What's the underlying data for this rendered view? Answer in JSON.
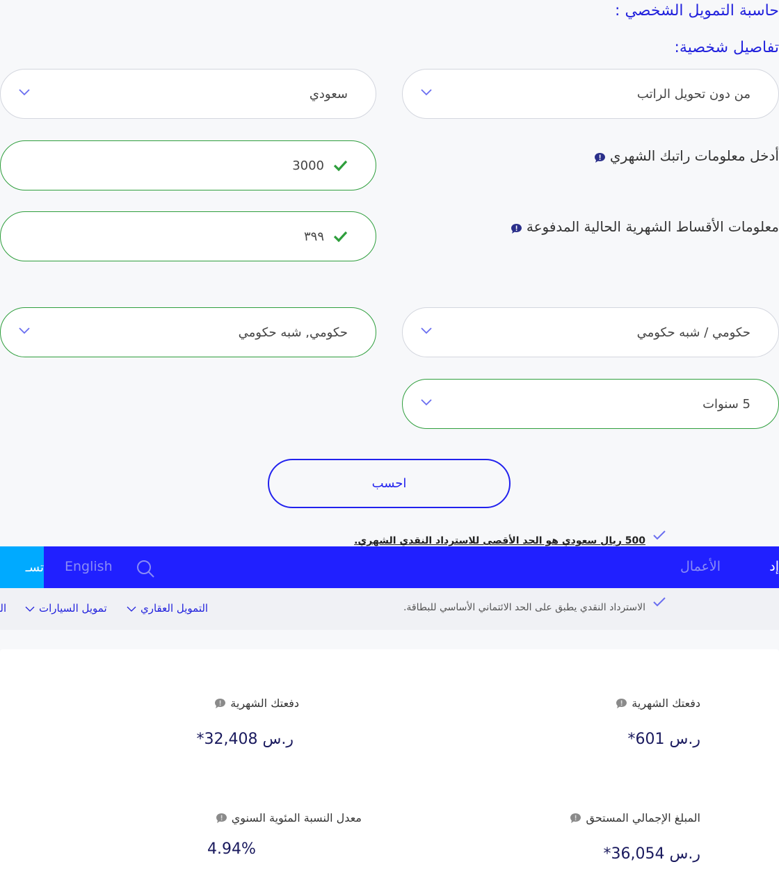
{
  "page": {
    "title": "حاسبة التمويل الشخصي :",
    "subtitle": "تفاصيل شخصية:"
  },
  "form": {
    "salary_transfer": {
      "value": "من دون تحويل الراتب",
      "icon": "chevron-down-icon"
    },
    "nationality": {
      "value": "سعودي",
      "icon": "chevron-down-icon"
    },
    "salary_label": "أدخل معلومات راتبك الشهري",
    "salary_value": "3000",
    "installments_label": "معلومات الأقساط الشهرية الحالية المدفوعة",
    "installments_value": "٣٩٩",
    "employer_type": {
      "value": "حكومي / شبه حكومي",
      "icon": "chevron-down-icon"
    },
    "employer_sector": {
      "value": "حكومي, شبه حكومي",
      "icon": "chevron-down-icon"
    },
    "tenure": {
      "value": "5 سنوات",
      "icon": "chevron-down-icon"
    },
    "calculate_label": "احسب"
  },
  "notes": [
    {
      "text": "500 ريال سعودي هو الحد الأقصى للاسترداد النقدي الشهري.",
      "icon": "check-icon"
    },
    {
      "text": "الاسترداد النقدي يطبق على الحد الائتماني الأساسي للبطاقة.",
      "icon": "check-icon"
    }
  ],
  "navbar": {
    "cut_left_label": "تسـ",
    "english_label": "English",
    "search_icon": "search-icon",
    "business_label": "الأعمال",
    "cut_right_label": "إد"
  },
  "subnav": {
    "items": [
      {
        "label": "التمويل العقاري"
      },
      {
        "label": "تمويل السيارات"
      },
      {
        "label": "الـ"
      }
    ]
  },
  "results": {
    "monthly_payment_right": {
      "label": "دفعتك الشهرية",
      "value": "ر.س 601*"
    },
    "monthly_payment_left": {
      "label": "دفعتك الشهرية",
      "value": "ر.س 32,408*"
    },
    "total_amount": {
      "label": "المبلغ الإجمالي المستحق",
      "value": "ر.س 36,054*"
    },
    "apr": {
      "label": "معدل النسبة المئوية السنوي",
      "value": "4.94%"
    }
  },
  "colors": {
    "accent_blue": "#2222ee",
    "valid_green": "#2e9e3c",
    "navbar_blue": "#2020ff",
    "navbar_cyan": "#00aaff",
    "result_value": "#1a1a5e"
  }
}
